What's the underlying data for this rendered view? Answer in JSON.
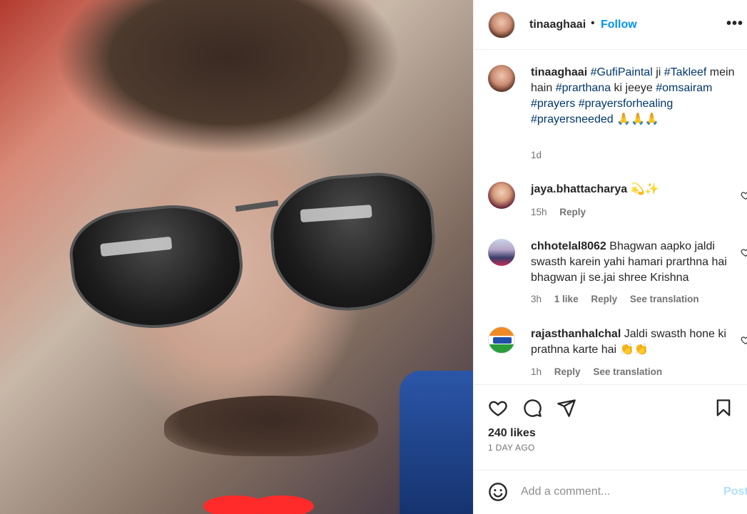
{
  "post": {
    "username": "tinaaghaai",
    "follow_label": "Follow",
    "more_label": "•••",
    "caption": {
      "user": "tinaaghaai",
      "parts": [
        {
          "t": "#GufiPaintal",
          "tag": true
        },
        {
          "t": " ji ",
          "tag": false
        },
        {
          "t": "#Takleef",
          "tag": true
        },
        {
          "t": " mein hain ",
          "tag": false
        },
        {
          "t": "#prarthana",
          "tag": true
        },
        {
          "t": " ki jeeye ",
          "tag": false
        },
        {
          "t": "#omsairam",
          "tag": true
        },
        {
          "t": " ",
          "tag": false
        },
        {
          "t": "#prayers",
          "tag": true
        },
        {
          "t": " ",
          "tag": false
        },
        {
          "t": "#prayersforhealing",
          "tag": true
        },
        {
          "t": " ",
          "tag": false
        },
        {
          "t": "#prayersneeded",
          "tag": true
        },
        {
          "t": " 🙏🙏🙏",
          "tag": false
        }
      ],
      "time": "1d"
    }
  },
  "comments": [
    {
      "user": "jaya.bhattacharya",
      "text": " 💫✨",
      "time": "15h",
      "likes": "",
      "reply": "Reply",
      "translate": ""
    },
    {
      "user": "chhotelal8062",
      "text": " Bhagwan aapko jaldi swasth karein yahi hamari prarthna hai bhagwan ji se.jai shree Krishna",
      "time": "3h",
      "likes": "1 like",
      "reply": "Reply",
      "translate": "See translation"
    },
    {
      "user": "rajasthanhalchal",
      "text": " Jaldi swasth hone ki prathna karte hai 👏👏",
      "time": "1h",
      "likes": "",
      "reply": "Reply",
      "translate": "See translation"
    }
  ],
  "actions": {
    "likes": "240 likes",
    "date": "1 DAY AGO"
  },
  "add_comment": {
    "placeholder": "Add a comment...",
    "post_label": "Post"
  },
  "icons": [
    "heart-icon",
    "comment-icon",
    "share-icon",
    "bookmark-icon",
    "emoji-icon",
    "more-icon"
  ],
  "colors": {
    "link": "#0095f6",
    "hashtag": "#00376b",
    "muted": "#737373",
    "post_disabled": "#b2dffc"
  }
}
